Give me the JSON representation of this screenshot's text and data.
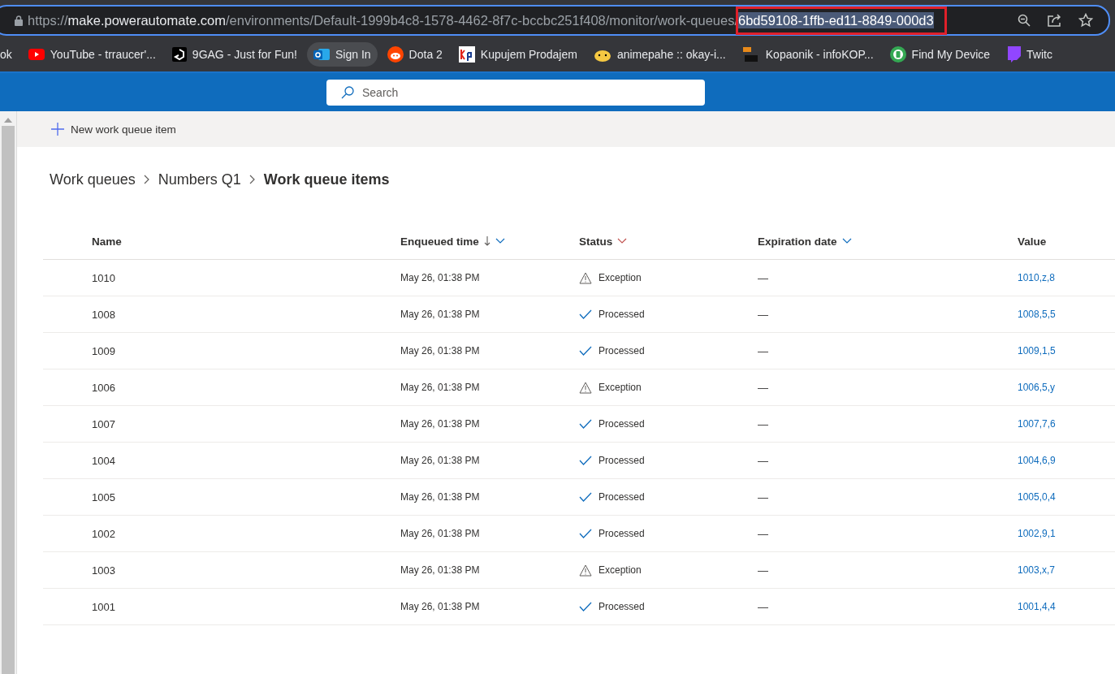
{
  "browser": {
    "url": {
      "scheme": "https://",
      "host": "make.powerautomate.com",
      "path": "/environments/Default-1999b4c8-1578-4462-8f7c-bccbc251f408/monitor/work-queues/",
      "selected": "6bd59108-1ffb-ed11-8849-000d3"
    },
    "bookmarks": [
      {
        "label": "ok"
      },
      {
        "label": "YouTube - trraucer'..."
      },
      {
        "label": "9GAG - Just for Fun!"
      },
      {
        "label": "Sign In",
        "selected": true
      },
      {
        "label": "Dota 2"
      },
      {
        "label": "Kupujem Prodajem"
      },
      {
        "label": "animepahe :: okay-i..."
      },
      {
        "label": "Kopaonik - infoKOP..."
      },
      {
        "label": "Find My Device"
      },
      {
        "label": "Twitc"
      }
    ]
  },
  "header": {
    "search": {
      "placeholder": "Search"
    }
  },
  "toolbar": {
    "new_item": "New work queue item"
  },
  "breadcrumb": [
    {
      "label": "Work queues",
      "current": false
    },
    {
      "label": "Numbers Q1",
      "current": false
    },
    {
      "label": "Work queue items",
      "current": true
    }
  ],
  "table": {
    "columns": [
      {
        "label": "Name"
      },
      {
        "label": "Enqueued time",
        "sorted": true,
        "menu": true
      },
      {
        "label": "Status",
        "menu": true
      },
      {
        "label": "Expiration date",
        "menu": true
      },
      {
        "label": "Value"
      }
    ],
    "rows": [
      {
        "name": "1010",
        "enqueued": "May 26, 01:38 PM",
        "status": {
          "kind": "exception",
          "label": "Exception"
        },
        "expiration": "—",
        "value": "1010,z,8"
      },
      {
        "name": "1008",
        "enqueued": "May 26, 01:38 PM",
        "status": {
          "kind": "processed",
          "label": "Processed"
        },
        "expiration": "—",
        "value": "1008,5,5"
      },
      {
        "name": "1009",
        "enqueued": "May 26, 01:38 PM",
        "status": {
          "kind": "processed",
          "label": "Processed"
        },
        "expiration": "—",
        "value": "1009,1,5"
      },
      {
        "name": "1006",
        "enqueued": "May 26, 01:38 PM",
        "status": {
          "kind": "exception",
          "label": "Exception"
        },
        "expiration": "—",
        "value": "1006,5,y"
      },
      {
        "name": "1007",
        "enqueued": "May 26, 01:38 PM",
        "status": {
          "kind": "processed",
          "label": "Processed"
        },
        "expiration": "—",
        "value": "1007,7,6"
      },
      {
        "name": "1004",
        "enqueued": "May 26, 01:38 PM",
        "status": {
          "kind": "processed",
          "label": "Processed"
        },
        "expiration": "—",
        "value": "1004,6,9"
      },
      {
        "name": "1005",
        "enqueued": "May 26, 01:38 PM",
        "status": {
          "kind": "processed",
          "label": "Processed"
        },
        "expiration": "—",
        "value": "1005,0,4"
      },
      {
        "name": "1002",
        "enqueued": "May 26, 01:38 PM",
        "status": {
          "kind": "processed",
          "label": "Processed"
        },
        "expiration": "—",
        "value": "1002,9,1"
      },
      {
        "name": "1003",
        "enqueued": "May 26, 01:38 PM",
        "status": {
          "kind": "exception",
          "label": "Exception"
        },
        "expiration": "—",
        "value": "1003,x,7"
      },
      {
        "name": "1001",
        "enqueued": "May 26, 01:38 PM",
        "status": {
          "kind": "processed",
          "label": "Processed"
        },
        "expiration": "—",
        "value": "1001,4,4"
      }
    ]
  }
}
